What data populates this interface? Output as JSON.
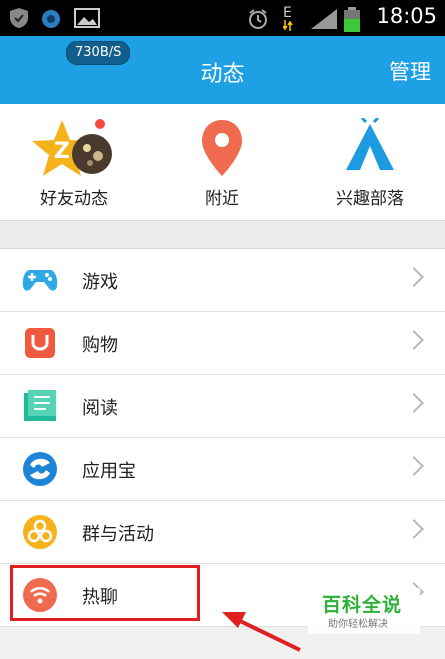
{
  "status_bar": {
    "time": "18:05",
    "network": "E"
  },
  "header": {
    "speed": "730B/S",
    "title": "动态",
    "manage": "管理"
  },
  "quick_actions": [
    {
      "label": "好友动态",
      "icon": "star-z-icon"
    },
    {
      "label": "附近",
      "icon": "location-pin-icon"
    },
    {
      "label": "兴趣部落",
      "icon": "tent-icon"
    }
  ],
  "menu": [
    {
      "label": "游戏",
      "icon": "gamepad-icon"
    },
    {
      "label": "购物",
      "icon": "shopping-bag-icon"
    },
    {
      "label": "阅读",
      "icon": "book-icon"
    },
    {
      "label": "应用宝",
      "icon": "app-store-icon"
    },
    {
      "label": "群与活动",
      "icon": "group-activity-icon"
    },
    {
      "label": "热聊",
      "icon": "hot-chat-icon"
    }
  ],
  "watermark": {
    "main": "百科全说",
    "sub": "助你轻松解决"
  },
  "colors": {
    "header": "#1ea0e4",
    "highlight": "#e02020",
    "watermark": "#2fb036"
  }
}
